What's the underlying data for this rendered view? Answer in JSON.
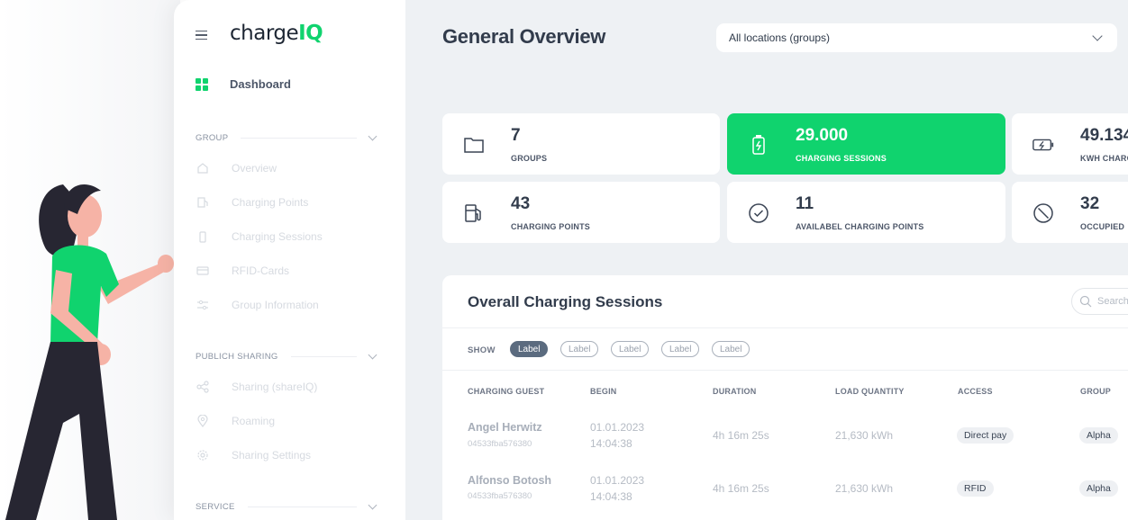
{
  "app": {
    "logo_main": "charge",
    "logo_accent": "IQ"
  },
  "sidebar": {
    "dashboard_label": "Dashboard",
    "sections": [
      {
        "title": "GROUP",
        "items": [
          "Overview",
          "Charging Points",
          "Charging Sessions",
          "RFID-Cards",
          "Group Information"
        ]
      },
      {
        "title": "PUBLICH SHARING",
        "items": [
          "Sharing (shareIQ)",
          "Roaming",
          "Sharing Settings"
        ]
      },
      {
        "title": "SERVICE",
        "items": []
      }
    ]
  },
  "header": {
    "title": "General Overview",
    "location_select": "All locations (groups)"
  },
  "stats": [
    {
      "value": "7",
      "label": "GROUPS",
      "icon": "folder-icon"
    },
    {
      "value": "29.000",
      "label": "CHARGING SESSIONS",
      "icon": "battery-charging-icon"
    },
    {
      "value": "49.134",
      "label": "KWH CHARGED",
      "icon": "battery-bolt-icon"
    },
    {
      "value": "43",
      "label": "CHARGING POINTS",
      "icon": "fuel-pump-icon"
    },
    {
      "value": "11",
      "label": "AVAILABEL CHARGING POINTS",
      "icon": "check-circle-icon"
    },
    {
      "value": "32",
      "label": "OCCUPIED",
      "icon": "blocked-icon"
    }
  ],
  "sessions": {
    "title": "Overall Charging Sessions",
    "search_placeholder": "Search",
    "show_label": "SHOW",
    "chips": [
      "Label",
      "Label",
      "Label",
      "Label",
      "Label"
    ],
    "columns": [
      "CHARGING GUEST",
      "BEGIN",
      "DURATION",
      "LOAD QUANTITY",
      "ACCESS",
      "GROUP"
    ],
    "rows": [
      {
        "name": "Angel Herwitz",
        "id": "04533fba576380",
        "date": "01.01.2023",
        "time": "14:04:38",
        "duration": "4h 16m 25s",
        "load": "21,630 kWh",
        "access": "Direct pay",
        "group": "Alpha"
      },
      {
        "name": "Alfonso Botosh",
        "id": "04533fba576380",
        "date": "01.01.2023",
        "time": "14:04:38",
        "duration": "4h 16m 25s",
        "load": "21,630 kWh",
        "access": "RFID",
        "group": "Alpha"
      }
    ]
  },
  "colors": {
    "accent": "#10d36e",
    "background": "#eef1f4",
    "text_dark": "#323c4c"
  }
}
